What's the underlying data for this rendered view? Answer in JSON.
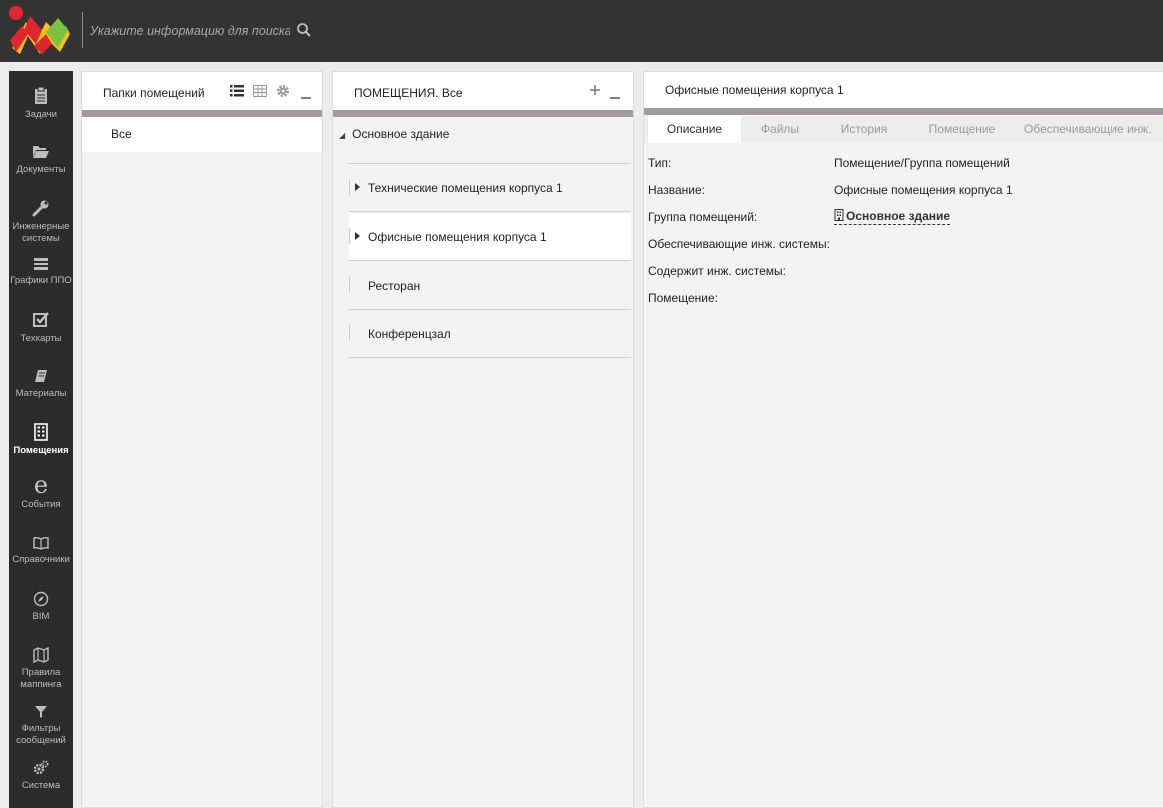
{
  "search": {
    "placeholder": "Укажите информацию для поиска"
  },
  "nav": {
    "tasks": "Задачи",
    "documents": "Документы",
    "engineering_1": "Инженерные",
    "engineering_2": "системы",
    "ppo": "Графики ППО",
    "techcards": "Техкарты",
    "materials": "Материалы",
    "rooms": "Помещения",
    "events": "События",
    "refs": "Справочники",
    "bim": "BIM",
    "mapping_1": "Правила",
    "mapping_2": "маппинга",
    "filters_1": "Фильтры",
    "filters_2": "сообщений",
    "system": "Система"
  },
  "folders_panel": {
    "title": "Папки помещений",
    "items": [
      "Все"
    ]
  },
  "rooms_panel": {
    "title": "ПОМЕЩЕНИЯ. Все",
    "root": "Основное здание",
    "nodes": [
      "Технические помещения корпуса 1",
      "Офисные помещения корпуса 1",
      "Ресторан",
      "Конференцзал"
    ]
  },
  "details": {
    "title": "Офисные помещения корпуса 1",
    "tabs": [
      "Описание",
      "Файлы",
      "История",
      "Помещение",
      "Обеспечивающие инж."
    ],
    "props": {
      "type_label": "Тип:",
      "type_value": "Помещение/Группа помещений",
      "name_label": "Название:",
      "name_value": "Офисные помещения корпуса 1",
      "group_label": "Группа помещений:",
      "group_value": "Основное здание",
      "providing_label": "Обеспечивающие инж. системы:",
      "contains_label": "Содержит инж. системы:",
      "room_label": "Помещение:"
    }
  },
  "colors": {
    "topbar": "#333333",
    "sidenav": "#2c2c2c",
    "panel_band": "#a59aa3",
    "logo_red": "#e0262f",
    "logo_yellow": "#f3c316",
    "logo_green": "#7cc242"
  }
}
